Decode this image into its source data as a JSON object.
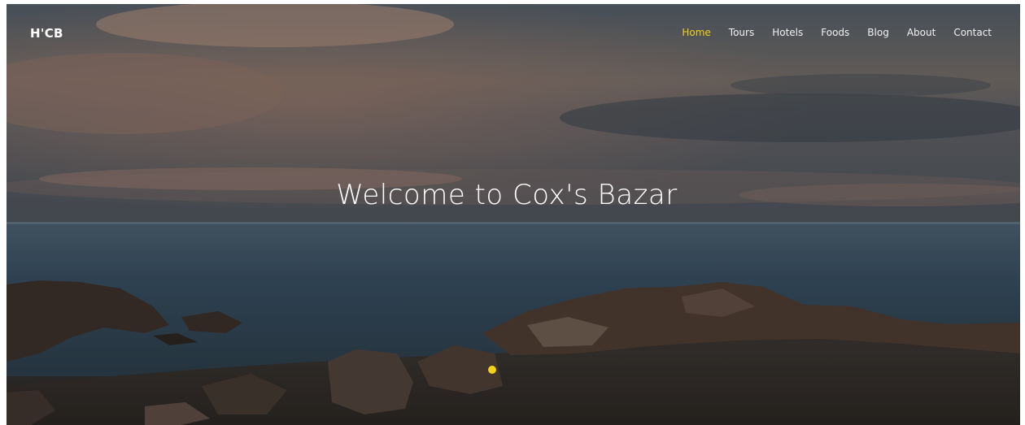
{
  "brand": "H'CB",
  "nav": {
    "items": [
      "Home",
      "Tours",
      "Hotels",
      "Foods",
      "Blog",
      "About",
      "Contact"
    ],
    "active": "Home"
  },
  "hero": {
    "headline": "Welcome to Cox's Bazar"
  },
  "colors": {
    "accent": "#f0d21a"
  }
}
